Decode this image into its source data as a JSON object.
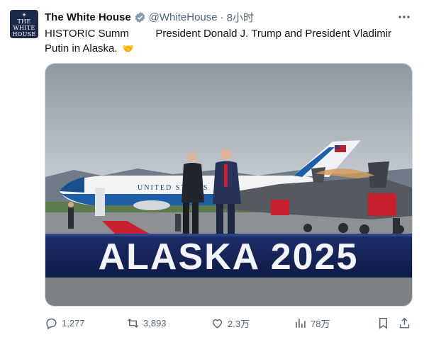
{
  "account": {
    "avatar_lines": [
      "THE",
      "WHITE",
      "HOUSE"
    ],
    "name": "The White House",
    "handle": "@WhiteHouse",
    "separator": "·",
    "time": "8小时"
  },
  "tweet": {
    "text": "HISTORIC Summ         President Donald J. Trump and President Vladimir Putin in Alaska.",
    "emoji": "🤝"
  },
  "media": {
    "plane_text": "UNITED STATES",
    "stage_text": "ALASKA 2025"
  },
  "actions": {
    "replies": "1,277",
    "reposts": "3,893",
    "likes": "2.3万",
    "views": "78万"
  },
  "colors": {
    "text": "#0f1419",
    "muted": "#536471",
    "verified": "#829aab",
    "avatar_bg": "#1b2a49"
  }
}
